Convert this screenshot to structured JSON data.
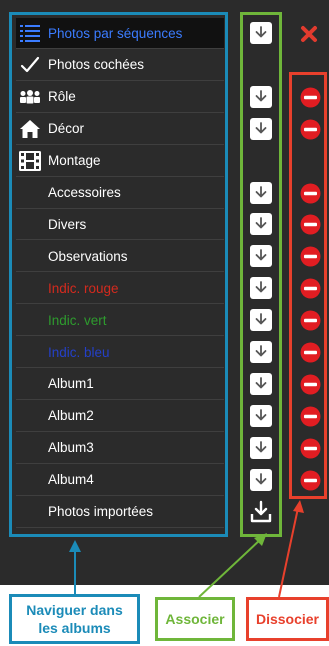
{
  "menu": {
    "items": [
      {
        "label": "Photos par séquences",
        "icon": "list-icon",
        "color": "#3b7cff"
      },
      {
        "label": "Photos cochées",
        "icon": "checkmark-icon",
        "color": "#ffffff"
      },
      {
        "label": "Rôle",
        "icon": "people-icon",
        "color": "#ffffff"
      },
      {
        "label": "Décor",
        "icon": "house-icon",
        "color": "#ffffff"
      },
      {
        "label": "Montage",
        "icon": "film-icon",
        "color": "#ffffff"
      },
      {
        "label": "Accessoires",
        "icon": "",
        "color": "#ffffff"
      },
      {
        "label": "Divers",
        "icon": "",
        "color": "#ffffff"
      },
      {
        "label": "Observations",
        "icon": "",
        "color": "#ffffff"
      },
      {
        "label": "Indic. rouge",
        "icon": "",
        "color": "#d42a1e"
      },
      {
        "label": "Indic. vert",
        "icon": "",
        "color": "#2e9b2e"
      },
      {
        "label": "Indic. bleu",
        "icon": "",
        "color": "#2440c8"
      },
      {
        "label": "Album1",
        "icon": "",
        "color": "#ffffff"
      },
      {
        "label": "Album2",
        "icon": "",
        "color": "#ffffff"
      },
      {
        "label": "Album3",
        "icon": "",
        "color": "#ffffff"
      },
      {
        "label": "Album4",
        "icon": "",
        "color": "#ffffff"
      },
      {
        "label": "Photos importées",
        "icon": "",
        "color": "#ffffff"
      }
    ]
  },
  "annotations": {
    "navigate": {
      "label": "Naviguer dans les albums",
      "color": "#1b8bb8"
    },
    "associate": {
      "label": "Associer",
      "color": "#6fb63a"
    },
    "dissociate": {
      "label": "Dissocier",
      "color": "#e8402c"
    }
  },
  "colors": {
    "panel_bg": "#2b2b2b",
    "selected_bg": "#111111",
    "close_x": "#e23b2e",
    "minus_red": "#e11d22"
  },
  "icons": {
    "close": "close-x-icon",
    "associate": "download-arrow-icon",
    "associate_last": "tray-download-icon",
    "dissociate": "red-minus-circle-icon"
  }
}
